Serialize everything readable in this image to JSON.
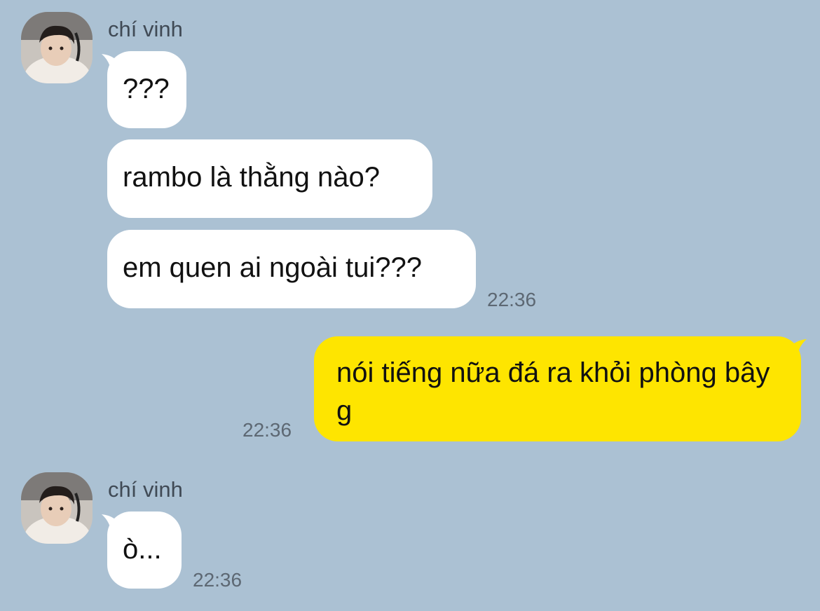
{
  "conversation": {
    "contact_name": "chí vinh",
    "avatar_icon": "profile-photo-icon",
    "colors": {
      "background": "#abc1d3",
      "incoming_bubble": "#ffffff",
      "outgoing_bubble": "#fee500",
      "timestamp": "#5d6873"
    },
    "groups": [
      {
        "sender": "chí vinh",
        "messages": [
          {
            "text": "???"
          },
          {
            "text": "rambo là thằng nào?"
          },
          {
            "text": "em quen ai ngoài tui???",
            "time": "22:36"
          }
        ]
      },
      {
        "sender": "me",
        "messages": [
          {
            "text": "nói tiếng nữa đá ra khỏi phòng bây g",
            "time": "22:36"
          }
        ]
      },
      {
        "sender": "chí vinh",
        "messages": [
          {
            "text": "ò...",
            "time": "22:36"
          }
        ]
      }
    ]
  }
}
